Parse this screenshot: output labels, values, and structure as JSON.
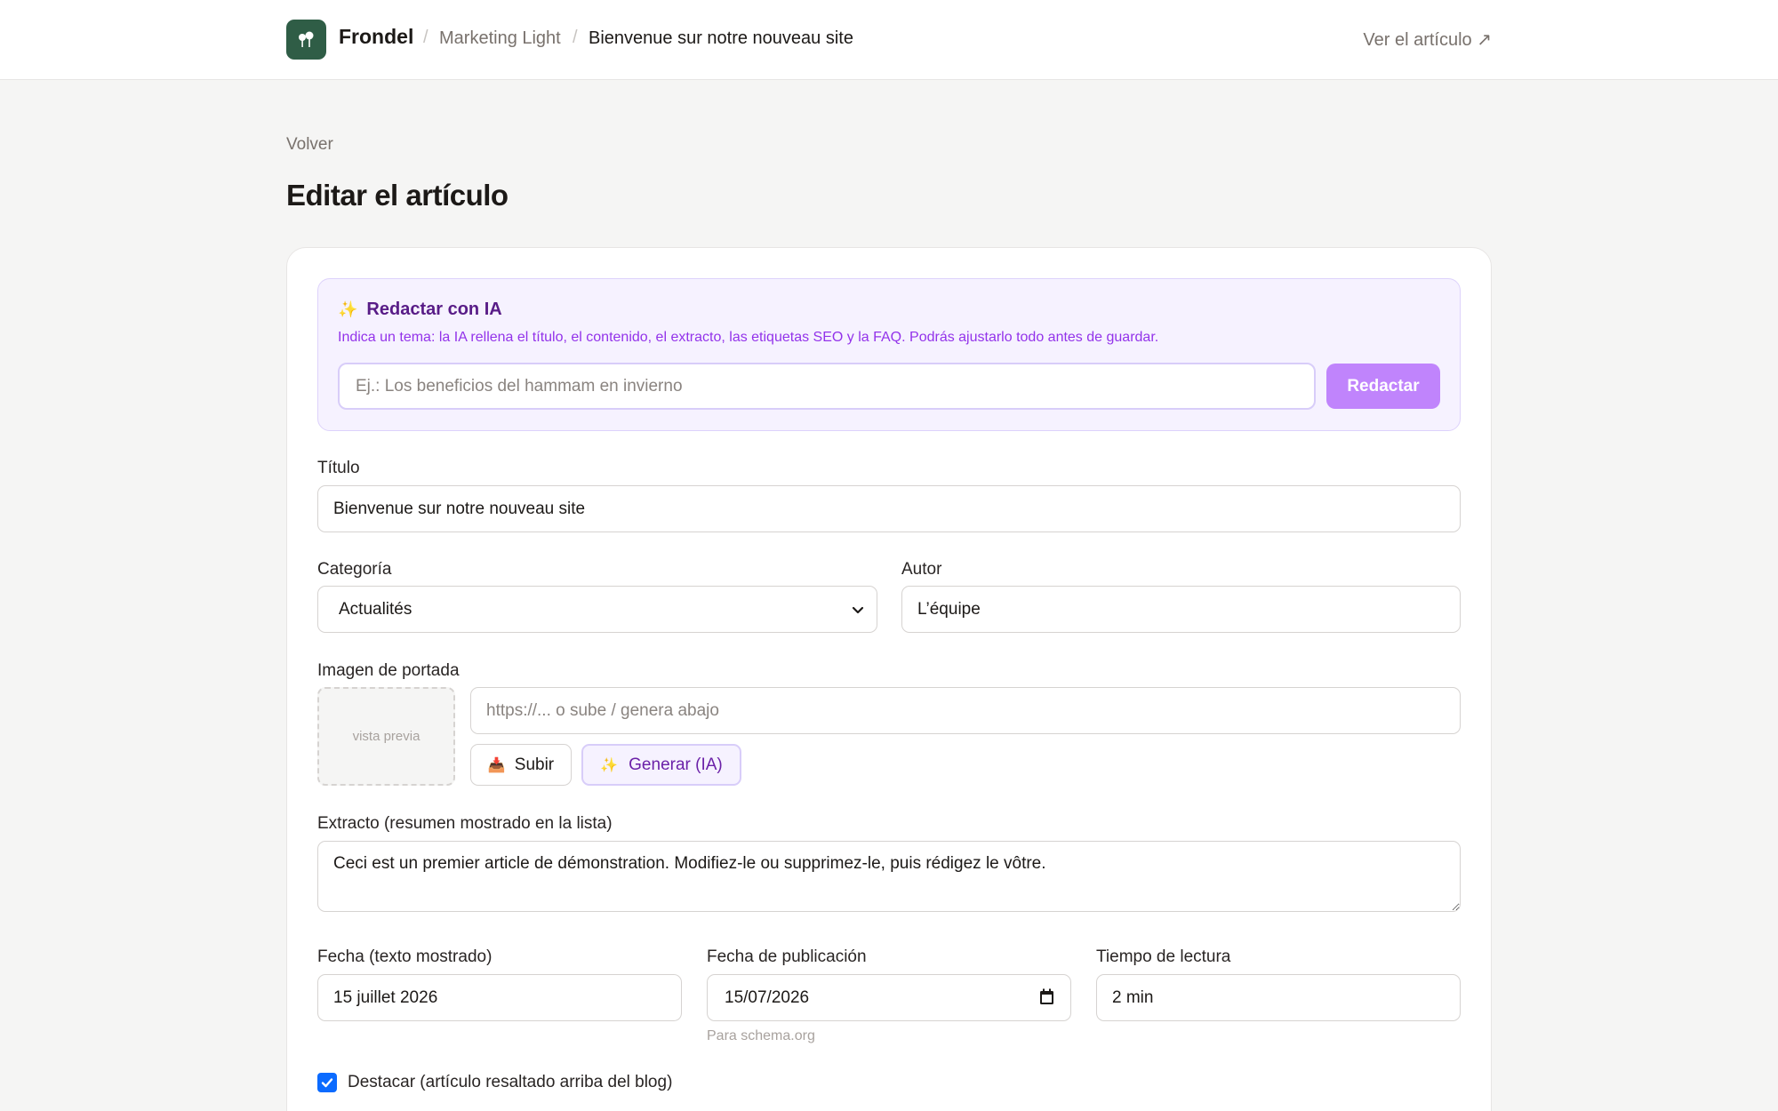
{
  "header": {
    "brand": "Frondel",
    "breadcrumb": {
      "separator": "/",
      "site": "Marketing Light",
      "current": "Bienvenue sur notre nouveau site"
    },
    "view_link": "Ver el artículo ↗"
  },
  "page": {
    "back": "Volver",
    "title": "Editar el artículo"
  },
  "ai_writer": {
    "sparkle": "✨",
    "title": "Redactar con IA",
    "description": "Indica un tema: la IA rellena el título, el contenido, el extracto, las etiquetas SEO y la FAQ. Podrás ajustarlo todo antes de guardar.",
    "placeholder": "Ej.: Los beneficios del hammam en invierno",
    "button": "Redactar"
  },
  "form": {
    "title_label": "Título",
    "title_value": "Bienvenue sur notre nouveau site",
    "category_label": "Categoría",
    "category_value": "Actualités",
    "author_label": "Autor",
    "author_value": "L’équipe",
    "cover_label": "Imagen de portada",
    "cover_preview": "vista previa",
    "cover_placeholder": "https://... o sube / genera abajo",
    "upload_icon": "📥",
    "upload_label": "Subir",
    "generate_icon": "✨",
    "generate_label": "Generar (IA)",
    "excerpt_label": "Extracto (resumen mostrado en la lista)",
    "excerpt_value": "Ceci est un premier article de démonstration. Modifiez-le ou supprimez-le, puis rédigez le vôtre.",
    "date_text_label": "Fecha (texto mostrado)",
    "date_text_value": "15 juillet 2026",
    "publish_date_label": "Fecha de publicación",
    "publish_date_value": "15/07/2026",
    "publish_date_hint": "Para schema.org",
    "reading_time_label": "Tiempo de lectura",
    "reading_time_value": "2 min",
    "featured_label": "Destacar (artículo resaltado arriba del blog)",
    "featured_checked": true
  },
  "colors": {
    "brand": "#2f5d46",
    "ai_accent": "#c084fc",
    "checkbox": "#0b6bff"
  }
}
